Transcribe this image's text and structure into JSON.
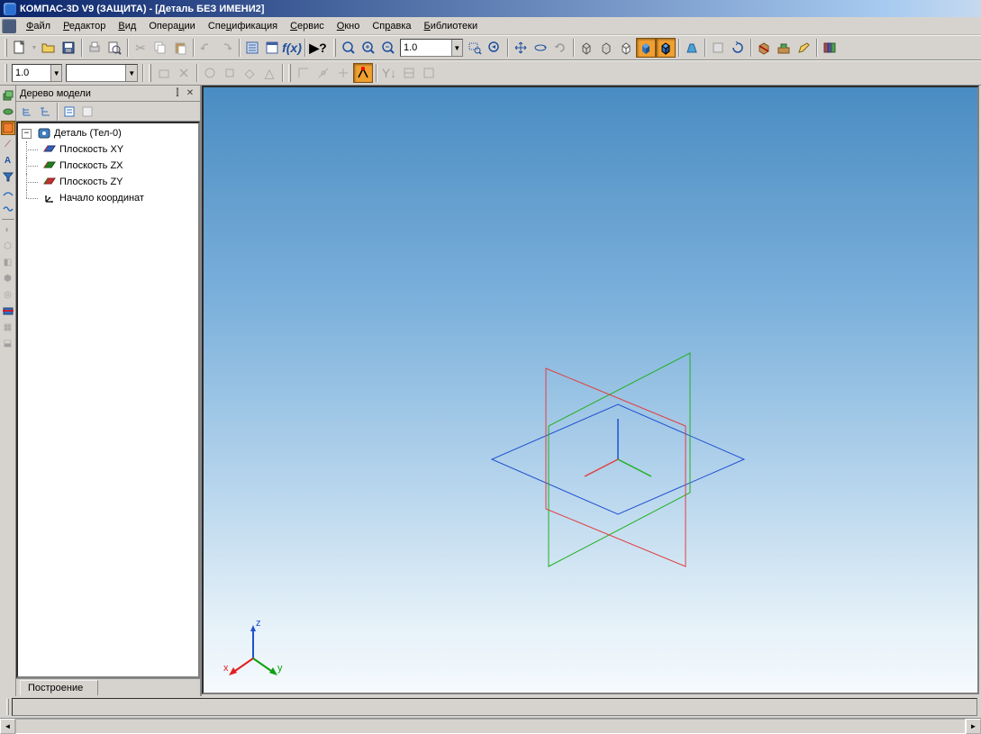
{
  "title": "КОМПАС-3D V9 (ЗАЩИТА) - [Деталь БЕЗ ИМЕНИ2]",
  "menus": [
    "Файл",
    "Редактор",
    "Вид",
    "Операции",
    "Спецификация",
    "Сервис",
    "Окно",
    "Справка",
    "Библиотеки"
  ],
  "combo1": "1.0",
  "zoom": "1.0",
  "panel_title": "Дерево модели",
  "tree": {
    "root": "Деталь (Тел-0)",
    "children": [
      "Плоскость XY",
      "Плоскость ZX",
      "Плоскость ZY",
      "Начало координат"
    ]
  },
  "tab": "Построение",
  "axes": {
    "x": "x",
    "y": "y",
    "z": "z"
  }
}
